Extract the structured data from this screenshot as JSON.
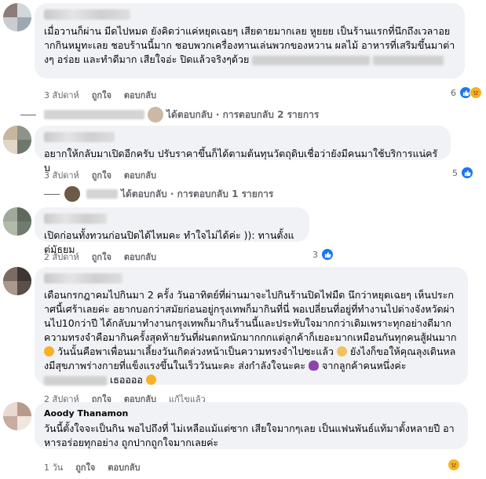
{
  "comments": [
    {
      "name": "",
      "text_main": "เมื่อวานก็ผ่าน มีดไปหมด ยังคิดว่าแค่หยุดเฉยๆ เสียดายมากเลย หูยยย เป็นร้านแรกที่นึกถึงเวลาอยากกินหมูทะเลย ชอบร้านนี้มาก ชอบพวกเครื่องทานเล่นพวกของหวาน ผลไม้ อาหารที่เสริมขึ้นมาต่างๆ อร่อย และทำดีมาก เสียใจอ่ะ ปิดแล้วจริงๆด้วย",
      "time": "3 สัปดาห์",
      "like_label": "ถูกใจ",
      "reply_label": "ตอบกลับ",
      "reaction_count": "6",
      "replies_text": "ได้ตอบกลับ · การตอบกลับ 2 รายการ"
    },
    {
      "name": "",
      "text_main": "อยากให้กลับมาเปิดอีกครับ ปรับราคาขึ้นก็ได้ตามต้นทุนวัตถุดิบเชื่อว่ายังมีคนมาใช้บริการแน่ครับ",
      "time": "3 สัปดาห์",
      "like_label": "ถูกใจ",
      "reply_label": "ตอบกลับ",
      "reaction_count": "5",
      "replies_text": "ได้ตอบกลับ · การตอบกลับ 1 รายการ"
    },
    {
      "name": "",
      "text_main": "เปิดก่อนทั้งทวนก่อนปิดได้ไหมคะ ทำใจไม่ได้ค่ะ )): ทานตั้งแต่มัธยม",
      "time": "2 สัปดาห์",
      "like_label": "ถูกใจ",
      "reply_label": "ตอบกลับ",
      "reaction_count": "3"
    },
    {
      "name": "",
      "text_main": "เดือนกรกฎาคมไปกินมา 2 ครั้ง วันอาทิตย์ที่ผ่านมาจะไปกินร้านปิดไฟมืด นึกว่าหยุดเฉยๆ เห็นประกาศนี้เศร้าเลยค่ะ อยากบอกว่าสมัยก่อนอยู่กรุงเทพก็มากินที่นี่ พอเปลี่ยนที่อยู่ที่ทำงานไปต่างจังหวัดผ่านไป10กว่าปี ได้กลับมาทำงานกรุงเทพก็มากินร้านนี้และประทับใจมากกว่าเดิมเพราะทุกอย่างดีมาก ความทรงจำคือมากินครั้งสุดท้ายวันที่ฝนตกหนักมากกกแต่ลูกค้าก็เยอะมากเหมือนกันทุกคนสู้ฝนมาก",
      "text_2": "วันนั้นคือพาเพื่อนมาเลี้ยงวันเกิดล่วงหน้าเป็นความทรงจำไปซะแล้ว",
      "text_3": "ยังไงก็ขอให้คุณลุงเดินหลงมีสุขภาพร่างกายที่แข็งแรงขึ้นในเร็ววันนะคะ ส่งกำลังใจนะคะ",
      "text_4": "จากลูกค้าคนหนึ่งค่ะ",
      "text_5": "เธออออ",
      "time": "2 สัปดาห์",
      "like_label": "ถูกใจ",
      "reply_label": "ตอบกลับ",
      "edited_label": "แก้ไขแล้ว"
    },
    {
      "name": "Aoody Thanamon",
      "text_main": "วันนี้ตั้งใจจะเป็นกิน พอไปถึงที่ ไม่เหลือแม้แต่ซาก เสียใจมากๆเลย เป็นแฟนพันธ์แท้มาตั้งหลายปี อาหารอร่อยทุกอย่าง ถูกปากถูกใจมากเลยค่ะ",
      "time": "1 วัน",
      "like_label": "ถูกใจ",
      "reply_label": "ตอบกลับ"
    }
  ],
  "icons": {
    "like": "thumbs-up-icon",
    "sad": "sad-face-icon",
    "reply_arrow": "reply-arrow-icon",
    "accent": "#1877f2",
    "sad_color": "#f7b125"
  }
}
